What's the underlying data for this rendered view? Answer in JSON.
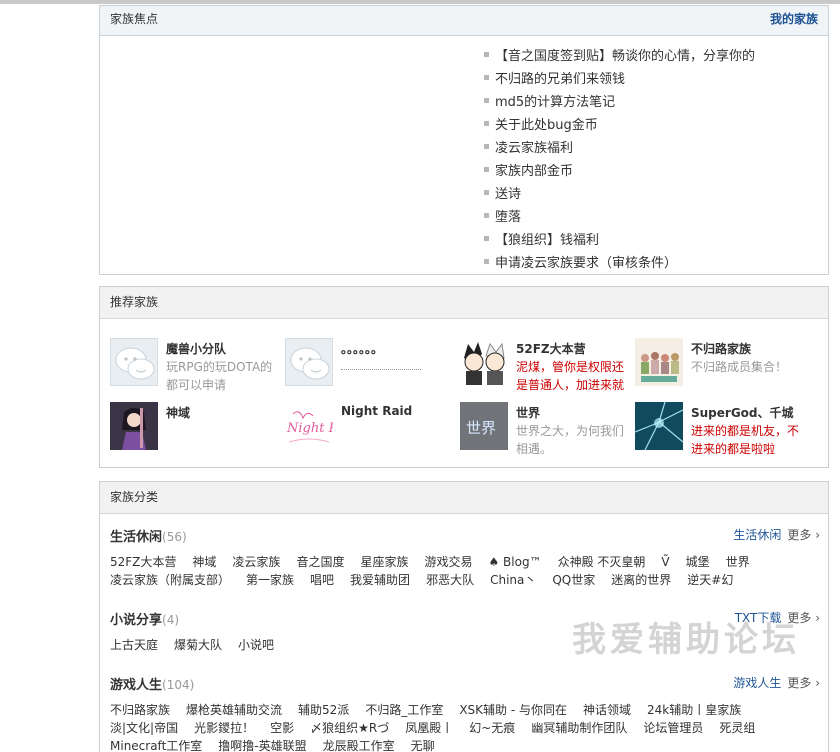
{
  "focus": {
    "title": "家族焦点",
    "more": "我的家族",
    "items": [
      "【音之国度签到贴】畅谈你的心情，分享你的",
      "不归路的兄弟们来领钱",
      "md5的计算方法笔记",
      "关于此处bug金币",
      "凌云家族福利",
      "家族内部金币",
      "送诗",
      "堕落",
      "【狼组织】钱福利",
      "申请凌云家族要求（审核条件）"
    ]
  },
  "recommend": {
    "title": "推荐家族",
    "families": [
      {
        "name": "魔兽小分队",
        "desc": "玩RPG的玩DOTA的都可以申请",
        "red": false
      },
      {
        "name": "",
        "desc": "。。。。。。",
        "red": false
      },
      {
        "name": "52FZ大本营",
        "desc": "泥煤，管你是权限还是普通人，加进来就",
        "red": true
      },
      {
        "name": "不归路家族",
        "desc": "不归路成员集合！",
        "red": false
      },
      {
        "name": "神域",
        "desc": "",
        "red": false
      },
      {
        "name": "Night Raid",
        "desc": "",
        "red": false
      },
      {
        "name": "世界",
        "desc": "世界之大，为何我们相遇。",
        "red": false
      },
      {
        "name": "SuperGod、千城",
        "desc": "进来的都是机友，不进来的都是啦啦",
        "red": true
      }
    ],
    "avatar_texts": {
      "world": "世界",
      "night": "Night Raid"
    }
  },
  "category": {
    "title": "家族分类",
    "more_label": "更多 ›",
    "groups": [
      {
        "name": "生活休闲",
        "count": "(56)",
        "sub": "生活休闲",
        "links": [
          "52FZ大本营",
          "神域",
          "凌云家族",
          "音之国度",
          "星座家族",
          "游戏交易",
          "♠ Blog™",
          "众神殿 不灭皇朝",
          "Ṽ",
          "城堡",
          "世界",
          "凌云家族（附属支部）",
          "第一家族",
          "唱吧",
          "我爱辅助团",
          "邪恶大队",
          "China丶",
          "QQ世家",
          "迷离的世界",
          "逆天#幻"
        ]
      },
      {
        "name": "小说分享",
        "count": "(4)",
        "sub": "TXT下载",
        "links": [
          "上古天庭",
          "爆菊大队",
          "小说吧"
        ]
      },
      {
        "name": "游戏人生",
        "count": "(104)",
        "sub": "游戏人生",
        "links": [
          "不归路家族",
          "爆枪英雄辅助交流",
          "辅助52派",
          "不归路_工作室",
          "XSK辅助 - 与你同在",
          "神话领域",
          "24k辅助丨皇家族",
          "淡|文化|帝国",
          "光影鑁拉！",
          "空影",
          "〆狼组织★Rづ",
          "凤凰殿丨",
          "幻~无痕",
          "幽冥辅助制作团队",
          "论坛管理员",
          "死灵组",
          "Minecraft工作室",
          "撸啊撸-英雄联盟",
          "龙辰殿工作室",
          "无聊"
        ]
      }
    ]
  },
  "watermark": "我爱辅助论坛"
}
